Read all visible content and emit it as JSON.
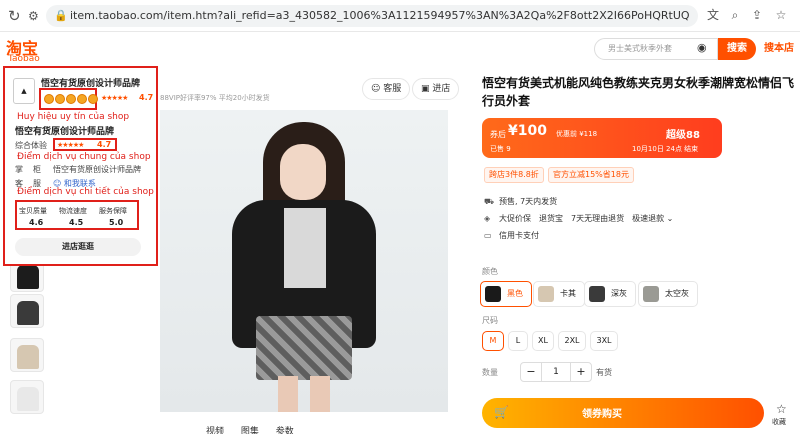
{
  "browser": {
    "url": "item.taobao.com/item.htm?ali_refid=a3_430582_1006%3A1121594957%3AN%3A2Qa%2F8ott2X2I66PoHQRtUQ%3D%3D%3Af33c8464f55a270..."
  },
  "header": {
    "logo_cn": "淘宝",
    "logo_en": "Taobao",
    "search_placeholder": "男士美式秋季外套",
    "search_button": "搜索",
    "tmall_button": "搜本店"
  },
  "shop_popup": {
    "logo_text": "悟空有货",
    "name": "悟空有货原创设计师品牌",
    "rating": "4.7",
    "annotation_reputation": "Huy hiệu uy tín của shop",
    "name_repeat": "悟空有货原创设计师品牌",
    "overall_label": "综合体验",
    "overall_rating": "4.7",
    "annotation_general": "Điểm dịch vụ chung của shop",
    "shop_label_1": "掌",
    "shop_label_2": "柜",
    "shop_value": "悟空有货原创设计师品牌",
    "contact_label_1": "客",
    "contact_label_2": "服",
    "contact_value": "和我联系",
    "annotation_detail": "Điểm dịch vụ chi tiết của shop",
    "scores": [
      {
        "label": "宝贝质量",
        "value": "4.6"
      },
      {
        "label": "物流速度",
        "value": "4.5"
      },
      {
        "label": "服务保障",
        "value": "5.0"
      }
    ],
    "visit_button": "进店逛逛"
  },
  "shop_meta": "88VIP好评率97%   平均20小时发货",
  "service_buttons": {
    "chat": "客服",
    "shop": "进店"
  },
  "image_tabs": [
    "视频",
    "图集",
    "参数"
  ],
  "product": {
    "title": "悟空有货美式机能风纯色教练夹克男女秋季潮牌宽松情侣飞行员外套",
    "price_label": "券后",
    "price": "¥100",
    "original_price": "优惠前 ¥118",
    "sold": "已售 9",
    "super_label": "超级88",
    "deadline": "10月10日 24点 结束",
    "promos": [
      "跨店3件8.8折",
      "官方立减15%省18元"
    ],
    "services": {
      "shipping": "预售, 7天内发货",
      "guarantees": [
        "大促价保",
        "退货宝",
        "7天无理由退货",
        "极速退款"
      ],
      "payment": "信用卡支付"
    },
    "color_label": "颜色",
    "colors": [
      {
        "name": "黑色",
        "color": "#1a1a1a"
      },
      {
        "name": "卡其",
        "color": "#d6c7b1"
      },
      {
        "name": "深灰",
        "color": "#3a3a3a"
      },
      {
        "name": "太空灰",
        "color": "#9a9a94"
      }
    ],
    "selected_color": "黑色",
    "size_label": "尺码",
    "sizes": [
      "M",
      "L",
      "XL",
      "2XL",
      "3XL"
    ],
    "selected_size": "M",
    "qty_label": "数量",
    "quantity": "1",
    "stock": "有货",
    "buy_button": "领券购买",
    "favorite": "收藏"
  }
}
